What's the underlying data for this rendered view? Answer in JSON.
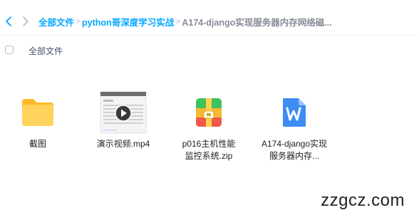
{
  "nav": {
    "breadcrumb": [
      {
        "label": "全部文件",
        "current": false
      },
      {
        "label": "python哥深度学习实战",
        "current": false
      },
      {
        "label": "A174-django实现服务器内存网络磁...",
        "current": true
      }
    ],
    "separator": ">"
  },
  "list_header": {
    "all_files_label": "全部文件",
    "select_all_checked": false
  },
  "files": [
    {
      "name": "截图",
      "type": "folder",
      "icon": "folder-icon"
    },
    {
      "name": "演示视频.mp4",
      "type": "video",
      "icon": "video-thumbnail-icon"
    },
    {
      "name": "p016主机性能监控系统.zip",
      "type": "zip",
      "icon": "zip-archive-icon"
    },
    {
      "name": "A174-django实现服务器内存...",
      "type": "word",
      "icon": "word-document-icon"
    }
  ],
  "watermark": "zzgcz.com",
  "colors": {
    "accent": "#06a7ff",
    "folder": "#ffc64a",
    "word": "#3e8bf5"
  }
}
